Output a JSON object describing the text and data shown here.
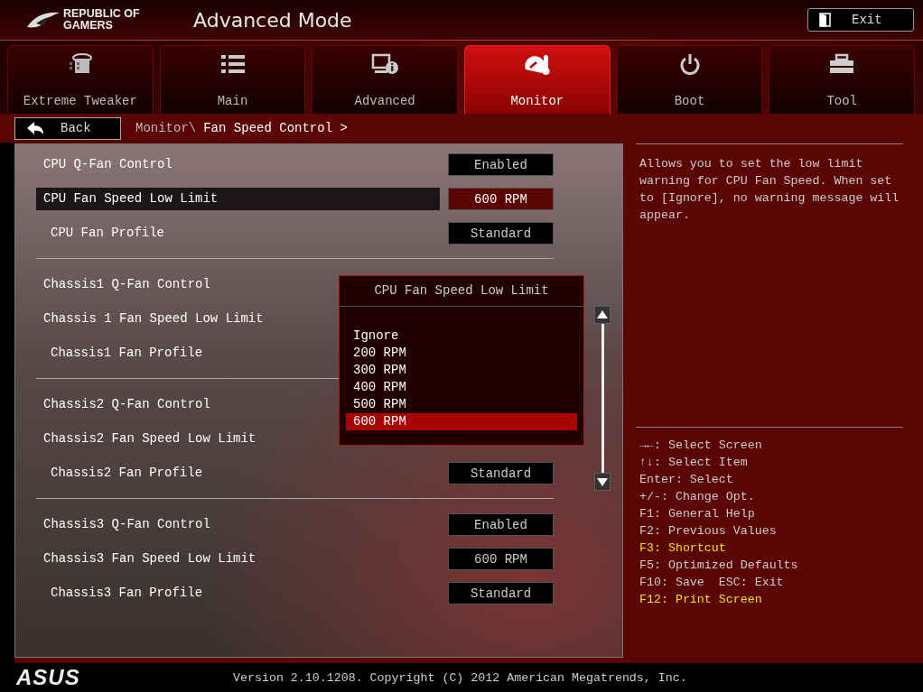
{
  "header": {
    "brand": "REPUBLIC OF GAMERS",
    "title": "Advanced Mode",
    "exit_button": "Exit"
  },
  "tabs": [
    {
      "label": "Extreme Tweaker",
      "selected": false
    },
    {
      "label": "Main",
      "selected": false
    },
    {
      "label": "Advanced",
      "selected": false
    },
    {
      "label": "Monitor",
      "selected": true
    },
    {
      "label": "Boot",
      "selected": false
    },
    {
      "label": "Tool",
      "selected": false
    }
  ],
  "back_button": "Back",
  "breadcrumb": {
    "path": "Monitor\\",
    "current": "Fan Speed Control >"
  },
  "settings": [
    [
      {
        "label": "CPU Q-Fan Control",
        "kind": "main",
        "value": "Enabled",
        "selected": false
      },
      {
        "label": "CPU Fan Speed Low Limit",
        "kind": "main",
        "value": "600 RPM",
        "selected": true
      },
      {
        "label": "CPU Fan Profile",
        "kind": "sub",
        "value": "Standard",
        "selected": false
      }
    ],
    [
      {
        "label": "Chassis1 Q-Fan Control",
        "kind": "main",
        "selected": false
      },
      {
        "label": "Chassis 1 Fan Speed Low Limit",
        "kind": "main",
        "selected": false
      },
      {
        "label": "Chassis1 Fan Profile",
        "kind": "sub",
        "selected": false
      }
    ],
    [
      {
        "label": "Chassis2 Q-Fan Control",
        "kind": "main",
        "selected": false
      },
      {
        "label": "Chassis2 Fan Speed Low Limit",
        "kind": "main",
        "selected": false
      },
      {
        "label": "Chassis2 Fan Profile",
        "kind": "sub",
        "value": "Standard",
        "selected": false
      }
    ],
    [
      {
        "label": "Chassis3 Q-Fan Control",
        "kind": "main",
        "value": "Enabled",
        "selected": false
      },
      {
        "label": "Chassis3 Fan Speed Low Limit",
        "kind": "main",
        "value": "600 RPM",
        "selected": false
      },
      {
        "label": "Chassis3 Fan Profile",
        "kind": "sub",
        "value": "Standard",
        "selected": false
      }
    ]
  ],
  "popup": {
    "title": "CPU Fan Speed Low Limit",
    "options": [
      {
        "label": "Ignore",
        "selected": false
      },
      {
        "label": "200 RPM",
        "selected": false
      },
      {
        "label": "300 RPM",
        "selected": false
      },
      {
        "label": "400 RPM",
        "selected": false
      },
      {
        "label": "500 RPM",
        "selected": false
      },
      {
        "label": "600 RPM",
        "selected": true
      }
    ]
  },
  "help_text": "Allows you to set the low limit warning for CPU Fan Speed. When set to [Ignore], no warning message will appear.",
  "shortcuts": [
    {
      "text": "→←: Select Screen",
      "highlighted": false
    },
    {
      "text": "↑↓: Select Item",
      "highlighted": false
    },
    {
      "text": "Enter: Select",
      "highlighted": false
    },
    {
      "text": "+/-: Change Opt.",
      "highlighted": false
    },
    {
      "text": "F1: General Help",
      "highlighted": false
    },
    {
      "text": "F2: Previous Values",
      "highlighted": false
    },
    {
      "text": "F3: Shortcut",
      "highlighted": true
    },
    {
      "text": "F5: Optimized Defaults",
      "highlighted": false
    },
    {
      "text": "F10: Save  ESC: Exit",
      "highlighted": false
    },
    {
      "text": "F12: Print Screen",
      "highlighted": true
    }
  ],
  "footer": {
    "logo": "ASUS",
    "version": "Version 2.10.1208. Copyright (C) 2012 American Megatrends, Inc."
  }
}
